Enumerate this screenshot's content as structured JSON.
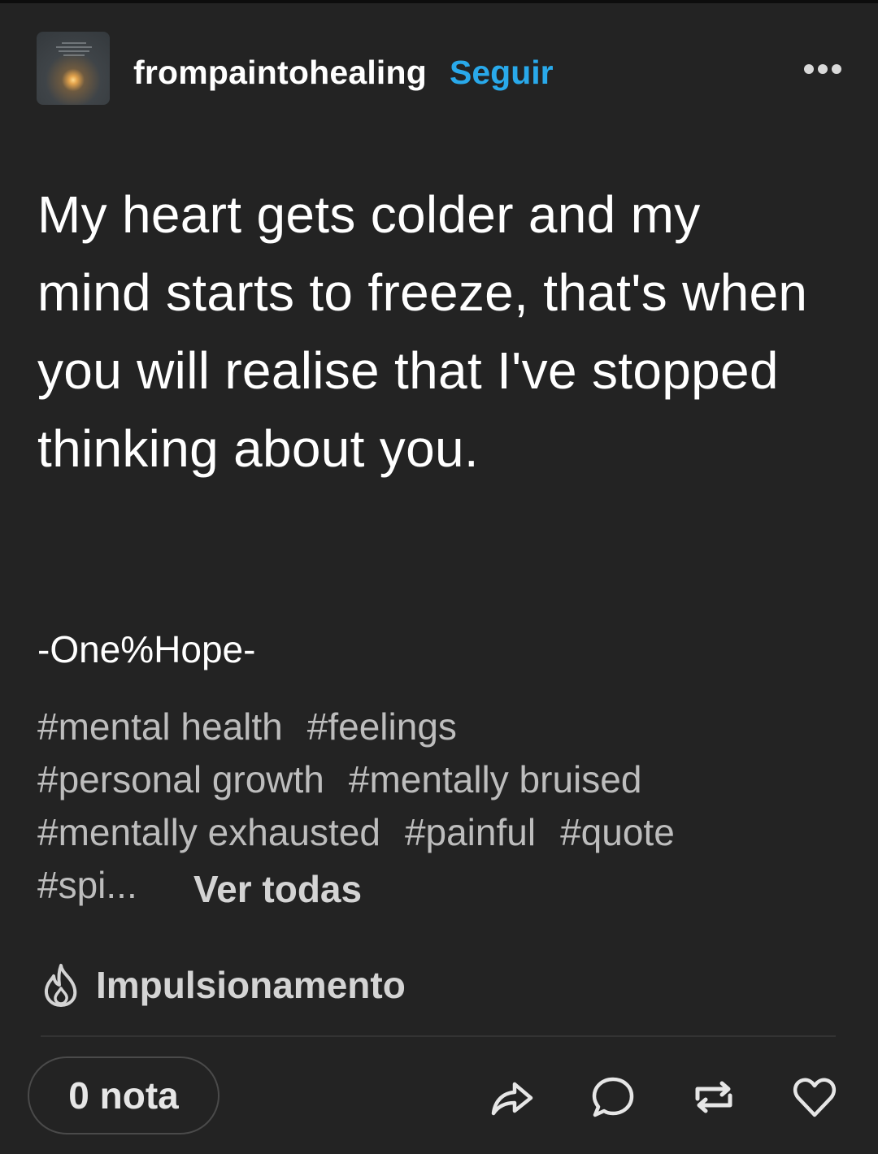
{
  "post": {
    "blog_name": "frompaintohealing",
    "follow_label": "Seguir",
    "more_icon": "more-horizontal-icon",
    "quote_text": "My heart gets colder and my mind starts to freeze, that's when you will realise that I've stopped thinking about you.",
    "signature": "-One%Hope-",
    "tags": [
      "#mental health",
      "#feelings",
      "#personal growth",
      "#mentally bruised",
      "#mentally exhausted",
      "#painful",
      "#quote",
      "#spi..."
    ],
    "see_all_label": "Ver todas",
    "boost_label": "Impulsionamento",
    "boost_icon": "flame-icon"
  },
  "footer": {
    "notes_label": "0 nota",
    "actions": [
      {
        "name": "share",
        "icon": "share-arrow-icon"
      },
      {
        "name": "reply",
        "icon": "speech-bubble-icon"
      },
      {
        "name": "reblog",
        "icon": "reblog-icon"
      },
      {
        "name": "like",
        "icon": "heart-icon"
      }
    ]
  },
  "colors": {
    "background": "#232323",
    "follow_accent": "#29a9ea",
    "tag_text": "#bdbdbd",
    "primary_text": "#ffffff"
  }
}
